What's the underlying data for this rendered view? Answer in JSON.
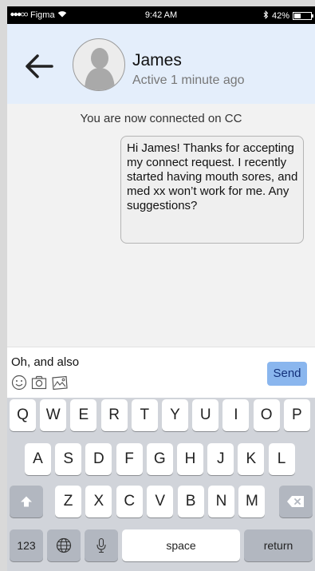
{
  "status_bar": {
    "carrier": "Figma",
    "time": "9:42 AM",
    "battery": "42%",
    "battery_level": 0.42
  },
  "header": {
    "contact_name": "James",
    "contact_status": "Active 1 minute ago"
  },
  "conversation": {
    "system_message": "You are now connected on CC",
    "messages": [
      {
        "text": "Hi James! Thanks for accepting my connect request. I recently started having mouth sores, and med xx won’t work for me. Any suggestions?"
      }
    ]
  },
  "composer": {
    "input_value": "Oh, and also",
    "send_label": "Send",
    "icons": [
      "smiley-icon",
      "camera-icon",
      "image-icon"
    ]
  },
  "keyboard": {
    "row1": [
      "Q",
      "W",
      "E",
      "R",
      "T",
      "Y",
      "U",
      "I",
      "O",
      "P"
    ],
    "row2": [
      "A",
      "S",
      "D",
      "F",
      "G",
      "H",
      "J",
      "K",
      "L"
    ],
    "row3": [
      "Z",
      "X",
      "C",
      "V",
      "B",
      "N",
      "M"
    ],
    "numbers_label": "123",
    "space_label": "space",
    "return_label": "return"
  },
  "colors": {
    "header_bg": "#e4eefb",
    "send_button": "#8ab6ee",
    "keyboard_bg": "#d1d4da"
  }
}
